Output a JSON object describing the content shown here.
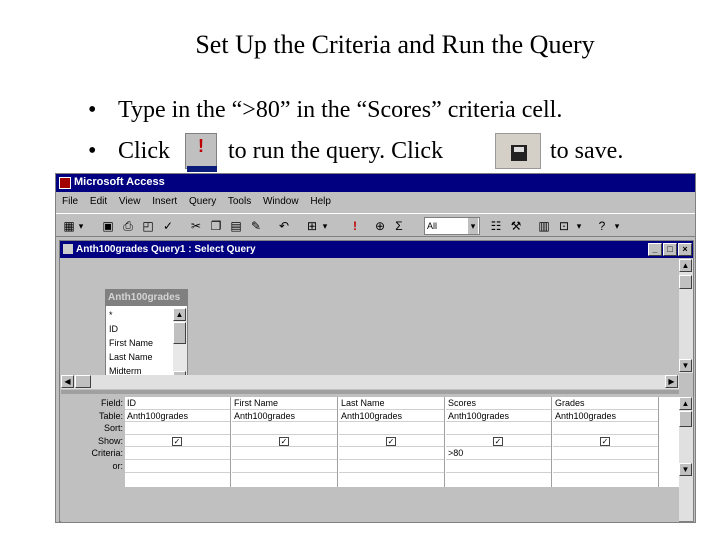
{
  "slide": {
    "title": "Set Up the Criteria and Run the Query",
    "bullet1": "Type in the “>80” in the “Scores” criteria cell.",
    "bullet2_part1": "Click",
    "bullet2_part2": "to run the query.  Click",
    "bullet2_part3": "to save.",
    "bullet_glyph": "•",
    "run_glyph": "!"
  },
  "app": {
    "title": "Microsoft Access",
    "menu": [
      "File",
      "Edit",
      "View",
      "Insert",
      "Query",
      "Tools",
      "Window",
      "Help"
    ],
    "toolbar": {
      "view_icon": "datasheet-view-icon",
      "run_glyph": "!",
      "sigma_glyph": "Σ",
      "top_values": "All",
      "help_glyph": "?"
    },
    "accent_color": "#000080"
  },
  "query_window": {
    "title": "Anth100grades Query1 : Select Query",
    "min_glyph": "_",
    "max_glyph": "□",
    "close_glyph": "×",
    "table_box": {
      "name": "Anth100grades",
      "fields": [
        "*",
        "ID",
        "First Name",
        "Last Name",
        "Midterm"
      ]
    },
    "row_labels": [
      "Field:",
      "Table:",
      "Sort:",
      "Show:",
      "Criteria:",
      "or:"
    ],
    "columns": [
      {
        "field": "ID",
        "table": "Anth100grades",
        "sort": "",
        "show": true,
        "criteria": "",
        "or": ""
      },
      {
        "field": "First Name",
        "table": "Anth100grades",
        "sort": "",
        "show": true,
        "criteria": "",
        "or": ""
      },
      {
        "field": "Last Name",
        "table": "Anth100grades",
        "sort": "",
        "show": true,
        "criteria": "",
        "or": ""
      },
      {
        "field": "Scores",
        "table": "Anth100grades",
        "sort": "",
        "show": true,
        "criteria": ">80",
        "or": ""
      },
      {
        "field": "Grades",
        "table": "Anth100grades",
        "sort": "",
        "show": true,
        "criteria": "",
        "or": ""
      }
    ],
    "check_glyph": "✓"
  }
}
